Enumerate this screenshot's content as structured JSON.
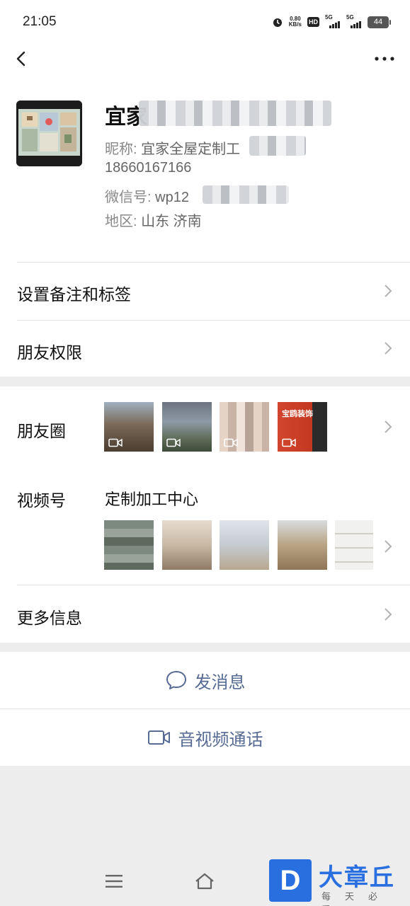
{
  "status": {
    "time": "21:05",
    "net_speed_value": "0.80",
    "net_speed_unit": "KB/s",
    "hd_label": "HD",
    "sim1_label": "5G",
    "sim2_label": "5G",
    "battery": "44"
  },
  "icons": {
    "back": "chevron-left-icon",
    "more": "more-dots-icon",
    "chevron": "chevron-right-icon",
    "message": "chat-bubble-icon",
    "video_call": "video-camera-icon",
    "menu": "menu-icon",
    "home": "home-icon"
  },
  "profile": {
    "name_visible": "宜家",
    "nickname_label": "昵称: ",
    "nickname_value": "宜家全屋定制工",
    "phone": "18660167166",
    "wechat_id_label": "微信号: ",
    "wechat_id_value": "wp12",
    "region_label": "地区: ",
    "region_value": "山东  济南"
  },
  "rows": {
    "remark": "设置备注和标签",
    "permissions": "朋友权限",
    "moments": "朋友圈",
    "channels": "视频号",
    "channels_name": "定制加工中心",
    "more_info": "更多信息"
  },
  "moments_thumb3_text": "宝鸥装饰",
  "actions": {
    "message": "发消息",
    "call": "音视频通话"
  },
  "watermark": {
    "logo_letter": "D",
    "title": "大章丘",
    "subtitle": "每天必看"
  },
  "colors": {
    "link": "#576b95",
    "page_bg": "#ededed",
    "watermark_blue": "#2a6fe0"
  }
}
